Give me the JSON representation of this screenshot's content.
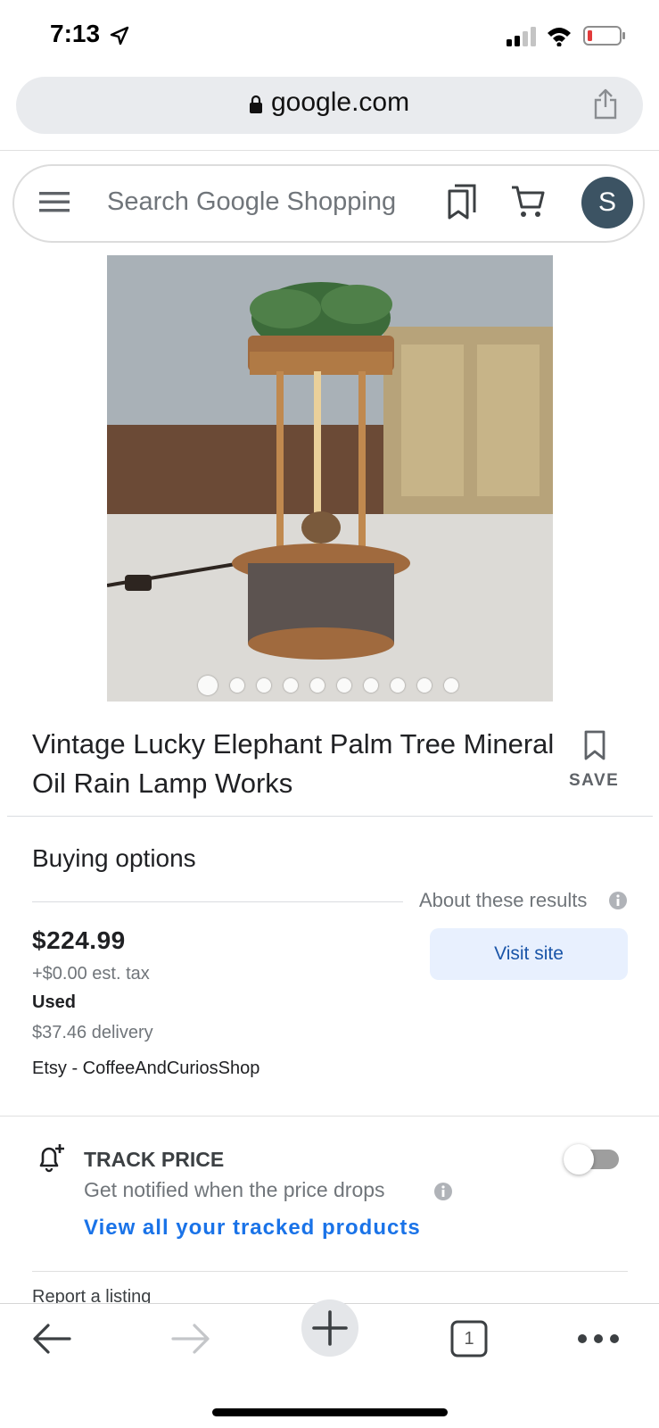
{
  "status_bar": {
    "time": "7:13"
  },
  "browser": {
    "url": "google.com",
    "tab_count": "1"
  },
  "search": {
    "placeholder": "Search Google Shopping",
    "avatar_letter": "S"
  },
  "product": {
    "title": "Vintage Lucky Elephant Palm Tree Mineral Oil Rain Lamp Works",
    "save_label": "SAVE",
    "image_count": 10,
    "active_image_index": 0
  },
  "buying_options": {
    "heading": "Buying options",
    "about": "About these results",
    "price": "$224.99",
    "tax": "+$0.00 est. tax",
    "condition": "Used",
    "delivery": "$37.46 delivery",
    "seller": "Etsy - CoffeeAndCuriosShop",
    "visit_label": "Visit site"
  },
  "track_price": {
    "title": "TRACK PRICE",
    "subtitle": "Get notified when the price drops",
    "link": "View all your tracked products",
    "enabled": false
  },
  "report": "Report a listing",
  "colors": {
    "link": "#1a73e8",
    "avatar": "#3c5363",
    "visit_bg": "#e8f0fe"
  },
  "icons": [
    "location-arrow-icon",
    "signal-icon",
    "wifi-icon",
    "battery-icon",
    "lock-icon",
    "share-icon",
    "menu-icon",
    "bookmarks-icon",
    "cart-icon",
    "bookmark-icon",
    "info-icon",
    "bell-plus-icon",
    "back-arrow-icon",
    "forward-arrow-icon",
    "plus-icon",
    "tabs-icon",
    "more-dots-icon"
  ]
}
